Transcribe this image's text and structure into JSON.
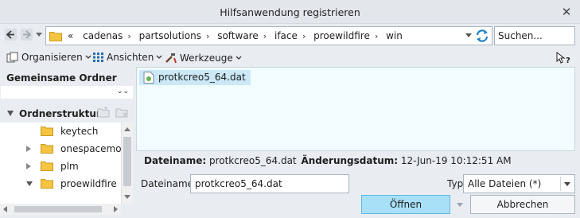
{
  "window": {
    "title": "Hilfsanwendung registrieren",
    "close_glyph": "✕"
  },
  "address_bar": {
    "overflow_glyph": "«",
    "crumbs": [
      "cadenas",
      "partsolutions",
      "software",
      "iface",
      "proewildfire",
      "win"
    ],
    "separator_glyph": "›"
  },
  "search": {
    "placeholder": "Suchen..."
  },
  "toolbar": {
    "organize_label": "Organisieren",
    "views_label": "Ansichten",
    "tools_label": "Werkzeuge",
    "help_icon": "whats-this-help-icon"
  },
  "sidebar": {
    "shared_folders_label": "Gemeinsame Ordner",
    "folder_structure_label": "Ordnerstruktur",
    "tree_items": [
      {
        "label": "keytech",
        "state": "none"
      },
      {
        "label": "onespacemode",
        "state": "closed"
      },
      {
        "label": "plm",
        "state": "closed"
      },
      {
        "label": "proewildfire",
        "state": "open"
      }
    ]
  },
  "file_list": {
    "files": [
      {
        "name": "protkcreo5_64.dat",
        "selected": true
      }
    ]
  },
  "details": {
    "filename_label": "Dateiname:",
    "filename_value": "protkcreo5_64.dat",
    "modified_label": "Änderungsdatum:",
    "modified_value": "12-Jun-19 10:12:51 AM"
  },
  "form": {
    "filename_label": "Dateiname:",
    "filename_value": "protkcreo5_64.dat",
    "type_label": "Typ",
    "type_value": "Alle Dateien (*)"
  },
  "buttons": {
    "open_label": "Öffnen",
    "cancel_label": "Abbrechen"
  },
  "colors": {
    "accent": "#a8e0f7",
    "selection": "#cce8f7",
    "folder": "#f5c542",
    "refresh": "#1f7fc4"
  }
}
